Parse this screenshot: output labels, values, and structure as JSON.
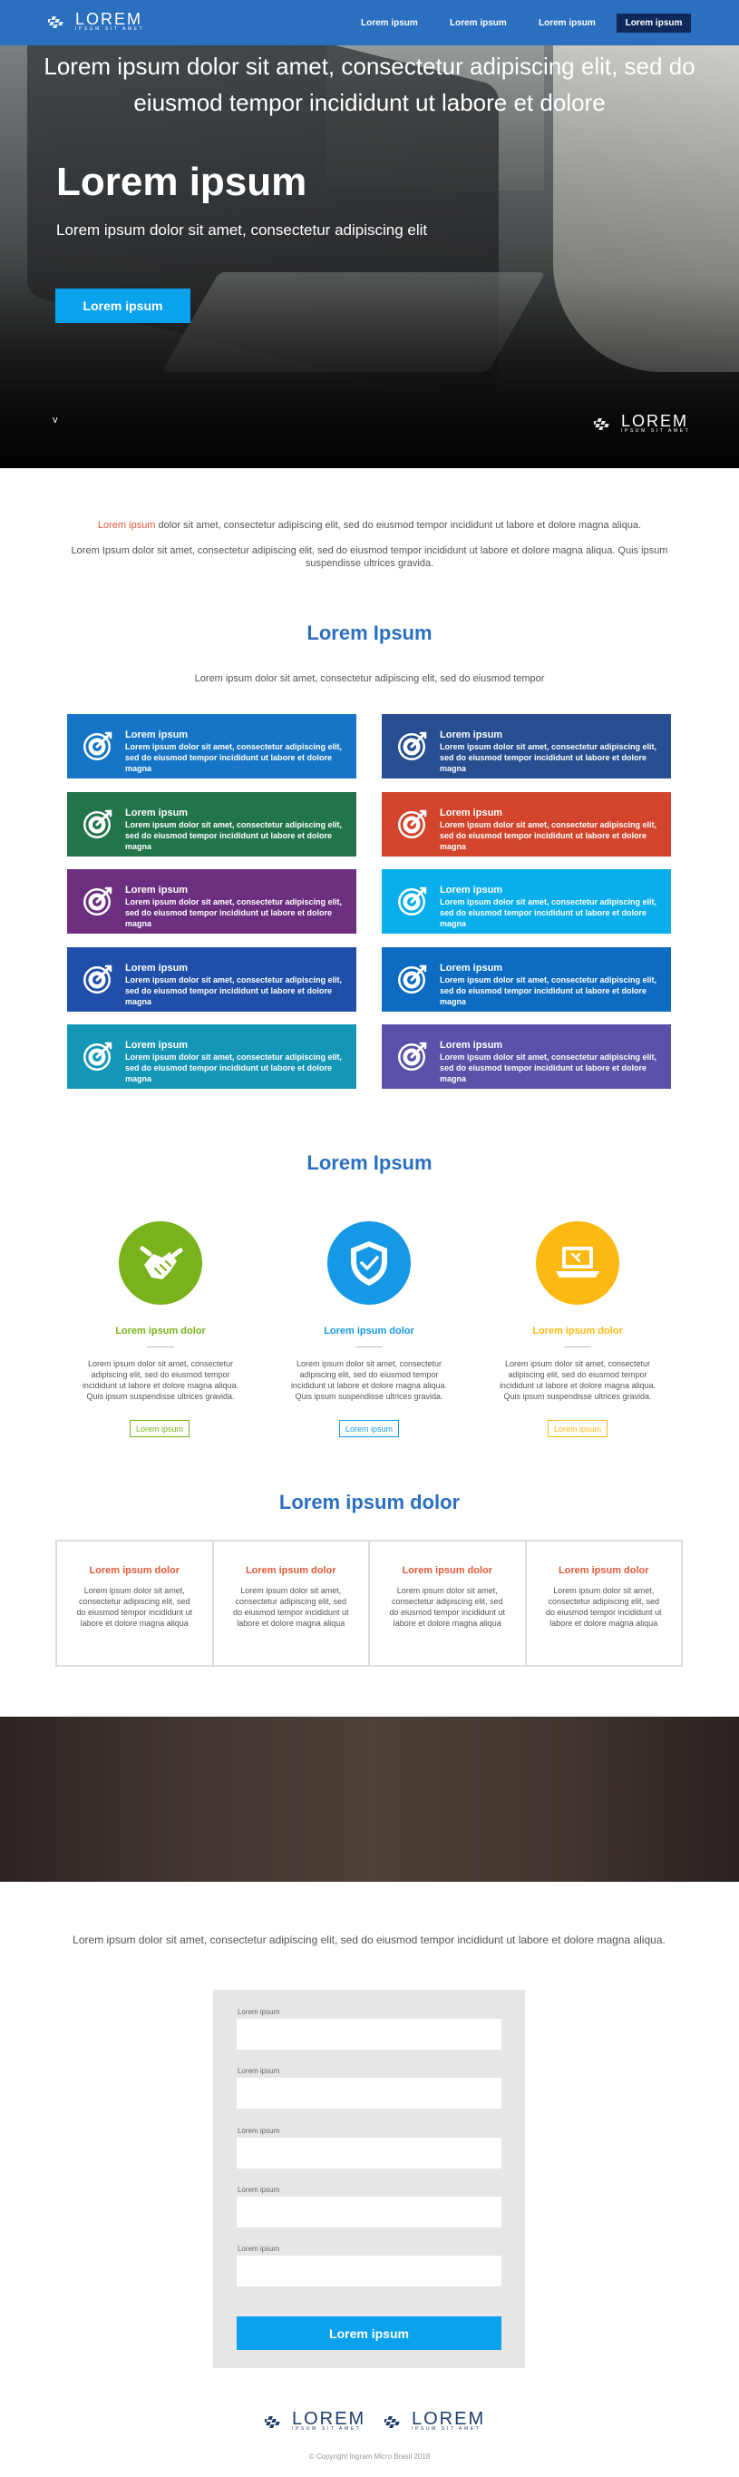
{
  "header": {
    "brand": "LOREM",
    "brand_tagline": "IPSUM SIT AMET",
    "nav": [
      "Lorem ipsum",
      "Lorem ipsum",
      "Lorem ipsum"
    ],
    "cta": "Lorem ipsum"
  },
  "hero": {
    "title": "Lorem ipsum",
    "subtitle": "Lorem ipsum dolor sit amet, consectetur adipiscing elit",
    "button": "Lorem ipsum",
    "chevron": "v",
    "brand": "LOREM",
    "brand_tagline": "IPSUM SIT AMET"
  },
  "intro": {
    "highlight": "Lorem ipsum",
    "line1_rest": " dolor sit amet, consectetur adipiscing elit, sed do eiusmod tempor incididunt ut labore et dolore magna aliqua.",
    "line2": "Lorem Ipsum dolor sit amet, consectetur adipiscing elit, sed do eiusmod tempor incididunt ut labore et dolore magna aliqua. Quis ipsum suspendisse ultrices gravida."
  },
  "services": {
    "title": "Lorem Ipsum",
    "subtitle": "Lorem ipsum dolor sit amet, consectetur adipiscing elit, sed do eiusmod tempor",
    "tiles": [
      {
        "title": "Lorem ipsum",
        "text": "Lorem ipsum dolor sit amet, consectetur adipiscing elit, sed do eiusmod tempor incididunt ut labore et dolore magna",
        "color": "#1675c6",
        "icon": "target-icon"
      },
      {
        "title": "Lorem ipsum",
        "text": "Lorem ipsum dolor sit amet, consectetur adipiscing elit, sed do eiusmod tempor incididunt ut labore et dolore magna",
        "color": "#264e91",
        "icon": "target-icon"
      },
      {
        "title": "Lorem ipsum",
        "text": "Lorem ipsum dolor sit amet, consectetur adipiscing elit, sed do eiusmod tempor incididunt ut labore et dolore magna",
        "color": "#22744a",
        "icon": "target-icon"
      },
      {
        "title": "Lorem ipsum",
        "text": "Lorem ipsum dolor sit amet, consectetur adipiscing elit, sed do eiusmod tempor incididunt ut labore et dolore magna",
        "color": "#d2452c",
        "icon": "target-icon"
      },
      {
        "title": "Lorem ipsum",
        "text": "Lorem ipsum dolor sit amet, consectetur adipiscing elit, sed do eiusmod tempor incididunt ut labore et dolore magna",
        "color": "#6c2f80",
        "icon": "target-icon"
      },
      {
        "title": "Lorem ipsum",
        "text": "Lorem ipsum dolor sit amet, consectetur adipiscing elit, sed do eiusmod tempor incididunt ut labore et dolore magna",
        "color": "#0aaeeb",
        "icon": "target-icon"
      },
      {
        "title": "Lorem ipsum",
        "text": "Lorem ipsum dolor sit amet, consectetur adipiscing elit, sed do eiusmod tempor incididunt ut labore et dolore magna",
        "color": "#1f4fa9",
        "icon": "target-icon"
      },
      {
        "title": "Lorem ipsum",
        "text": "Lorem ipsum dolor sit amet, consectetur adipiscing elit, sed do eiusmod tempor incididunt ut labore et dolore magna",
        "color": "#0d6cc2",
        "icon": "target-icon"
      },
      {
        "title": "Lorem ipsum",
        "text": "Lorem ipsum dolor sit amet, consectetur adipiscing elit, sed do eiusmod tempor incididunt ut labore et dolore magna",
        "color": "#1496b6",
        "icon": "target-icon"
      },
      {
        "title": "Lorem ipsum",
        "text": "Lorem ipsum dolor sit amet, consectetur adipiscing elit, sed do eiusmod tempor incididunt ut labore et dolore magna",
        "color": "#5a52a8",
        "icon": "target-icon"
      }
    ]
  },
  "features": {
    "title": "Lorem Ipsum",
    "items": [
      {
        "title": "Lorem ipsum dolor",
        "text": "Lorem ipsum dolor sit amet, consectetur adipiscing elit, sed do eiusmod tempor incididunt ut labore et dolore magna aliqua. Quis ipsum suspendisse ultrices gravida.",
        "button": "Lorem ipsum",
        "color": "#79b21a",
        "icon": "handshake-icon"
      },
      {
        "title": "Lorem ipsum dolor",
        "text": "Lorem ipsum dolor sit amet, consectetur adipiscing elit, sed do eiusmod tempor incididunt ut labore et dolore magna aliqua. Quis ipsum suspendisse ultrices gravida.",
        "button": "Lorem ipsum",
        "color": "#1599e6",
        "icon": "shield-check-icon"
      },
      {
        "title": "Lorem ipsum dolor",
        "text": "Lorem ipsum dolor sit amet, consectetur adipiscing elit, sed do eiusmod tempor incididunt ut labore et dolore magna aliqua. Quis ipsum suspendisse ultrices gravida.",
        "button": "Lorem ipsum",
        "color": "#fdb912",
        "icon": "laptop-icon"
      }
    ]
  },
  "boxes": {
    "title": "Lorem ipsum dolor",
    "items": [
      {
        "title": "Lorem ipsum dolor",
        "text": "Lorem ipsum dolor sit amet, consectetur adipiscing elit, sed do eiusmod tempor incididunt ut labore et dolore magna aliqua"
      },
      {
        "title": "Lorem ipsum dolor",
        "text": "Lorem ipsum dolor sit amet, consectetur adipiscing elit, sed do eiusmod tempor incididunt ut labore et dolore magna aliqua"
      },
      {
        "title": "Lorem ipsum dolor",
        "text": "Lorem ipsum dolor sit amet, consectetur adipiscing elit, sed do eiusmod tempor incididunt ut labore et dolore magna aliqua"
      },
      {
        "title": "Lorem ipsum dolor",
        "text": "Lorem ipsum dolor sit amet, consectetur adipiscing elit, sed do eiusmod tempor incididunt ut labore et dolore magna aliqua"
      }
    ]
  },
  "band": {
    "text": "Lorem ipsum dolor sit amet, consectetur adipiscing elit, sed do eiusmod tempor incididunt ut labore et dolore"
  },
  "contact": {
    "intro": "Lorem ipsum dolor sit amet, consectetur adipiscing elit, sed do eiusmod tempor incididunt ut labore et dolore magna aliqua.",
    "fields": [
      {
        "label": "Lorem ipsum",
        "value": ""
      },
      {
        "label": "Lorem ipsum",
        "value": ""
      },
      {
        "label": "Lorem ipsum",
        "value": ""
      },
      {
        "label": "Lorem ipsum",
        "value": ""
      },
      {
        "label": "Lorem ipsum",
        "value": ""
      }
    ],
    "submit": "Lorem ipsum"
  },
  "footer": {
    "logos": [
      {
        "brand": "LOREM",
        "tagline": "IPSUM SIT AMET"
      },
      {
        "brand": "LOREM",
        "tagline": "IPSUM SIT AMET"
      }
    ],
    "copyright": "© Copyright Ingram Micro Brasil 2018"
  }
}
